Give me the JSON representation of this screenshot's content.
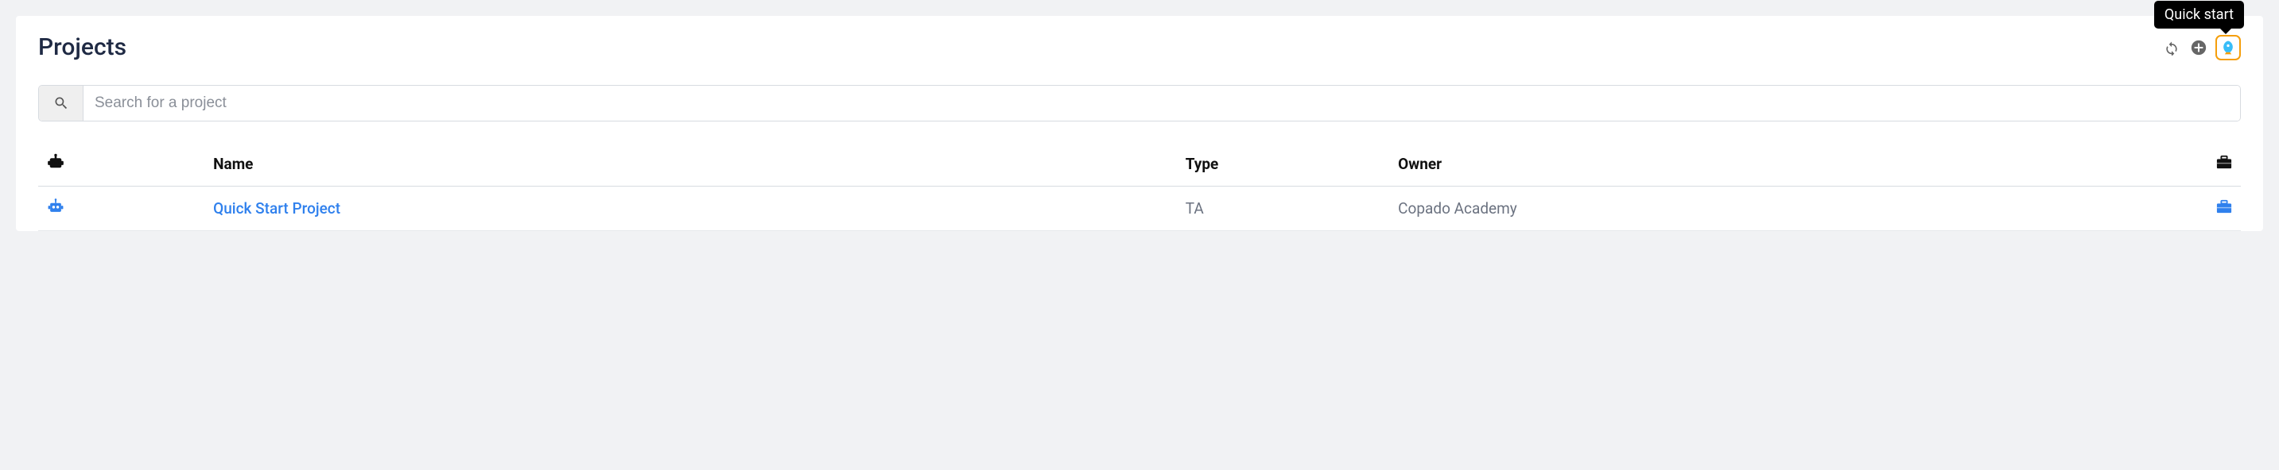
{
  "header": {
    "title": "Projects",
    "tooltip": "Quick start"
  },
  "search": {
    "placeholder": "Search for a project"
  },
  "table": {
    "columns": {
      "name": "Name",
      "type": "Type",
      "owner": "Owner"
    },
    "rows": [
      {
        "name": "Quick Start Project",
        "type": "TA",
        "owner": "Copado Academy"
      }
    ]
  }
}
